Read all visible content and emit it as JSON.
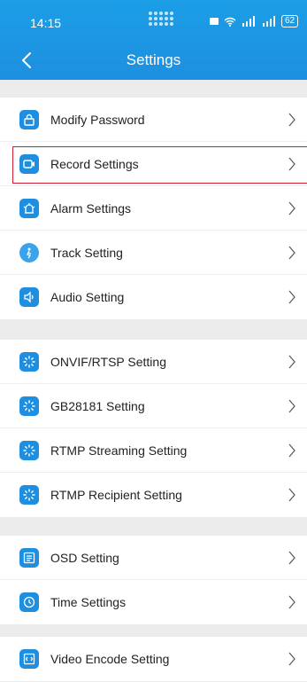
{
  "status_bar": {
    "time": "14:15",
    "network": "⁴ᴳ ⁵ᴳ",
    "battery": "62"
  },
  "header": {
    "title": "Settings"
  },
  "sections": [
    {
      "items": [
        {
          "label": "Modify Password",
          "icon": "lock-icon"
        },
        {
          "label": "Record Settings",
          "icon": "video-camera-icon",
          "highlighted": true
        },
        {
          "label": "Alarm Settings",
          "icon": "alarm-icon"
        },
        {
          "label": "Track Setting",
          "icon": "track-icon"
        },
        {
          "label": "Audio Setting",
          "icon": "speaker-icon"
        }
      ]
    },
    {
      "items": [
        {
          "label": "ONVIF/RTSP Setting",
          "icon": "loading-spinner-icon"
        },
        {
          "label": "GB28181 Setting",
          "icon": "loading-spinner-icon"
        },
        {
          "label": "RTMP Streaming Setting",
          "icon": "loading-spinner-icon"
        },
        {
          "label": "RTMP Recipient Setting",
          "icon": "loading-spinner-icon"
        }
      ]
    },
    {
      "items": [
        {
          "label": "OSD Setting",
          "icon": "osd-icon"
        },
        {
          "label": "Time Settings",
          "icon": "clock-icon"
        }
      ]
    },
    {
      "items": [
        {
          "label": "Video Encode Setting",
          "icon": "video-encode-icon"
        }
      ]
    }
  ],
  "colors": {
    "accent": "#1e8fe0",
    "highlight_border": "#d61f35",
    "background": "#ebebeb"
  }
}
